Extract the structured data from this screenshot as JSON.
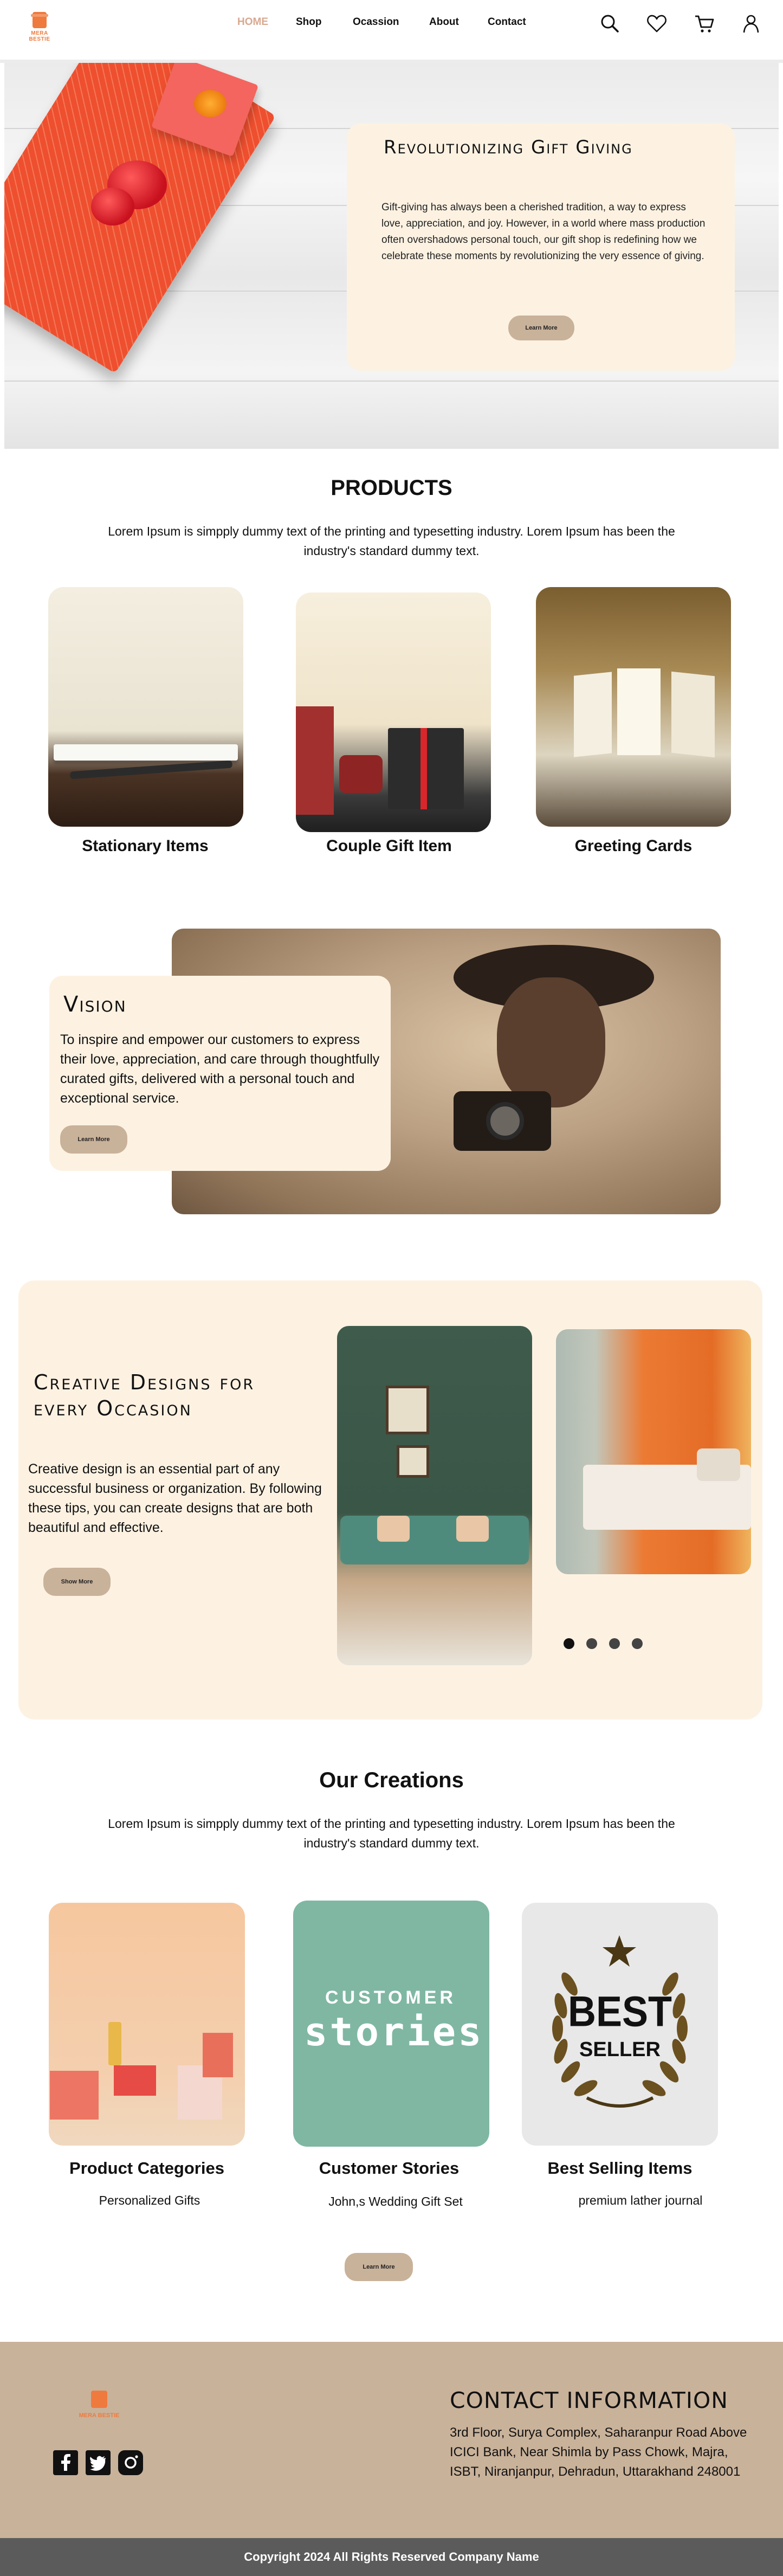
{
  "brand": {
    "logo_text": "MERA BESTIE",
    "accent": "#ef7a3e",
    "cream": "#fdf2e2",
    "tan": "#c9b29a"
  },
  "nav": {
    "items": [
      "HOME",
      "Shop",
      "Ocassion",
      "About",
      "Contact"
    ],
    "active": "HOME",
    "icons": [
      "search-icon",
      "heart-icon",
      "cart-icon",
      "user-icon"
    ]
  },
  "hero": {
    "title": "Revolutionizing Gift Giving",
    "text": "Gift-giving has always been a cherished tradition, a way to express love, appreciation, and joy. However, in a world where mass production often overshadows personal touch, our gift shop is redefining how we celebrate these moments by revolutionizing the very essence of giving.",
    "button": "Learn More"
  },
  "products": {
    "title": "PRODUCTS",
    "subtitle": "Lorem Ipsum is simpply dummy text of the printing and typesetting industry. Lorem Ipsum has been the industry's standard dummy text.",
    "items": [
      {
        "label": "Stationary Items"
      },
      {
        "label": "Couple Gift Item"
      },
      {
        "label": "Greeting Cards"
      }
    ]
  },
  "vision": {
    "title": "Vision",
    "text": "To inspire and empower our customers to express their love, appreciation, and care through thoughtfully curated gifts, delivered with a personal touch and exceptional service.",
    "button": "Learn More"
  },
  "creative": {
    "title": "Creative Designs for every Occasion",
    "text": "Creative design is an essential part of any successful business or organization. By following these tips, you can create designs that are both beautiful and effective.",
    "button": "Show More",
    "slides_count": 4,
    "active_slide": 1
  },
  "creations": {
    "title": "Our Creations",
    "subtitle": "Lorem Ipsum is simpply dummy text of the printing and typesetting industry. Lorem Ipsum has been the industry's standard dummy text.",
    "items": [
      {
        "label": "Product Categories",
        "sub": "Personalized Gifts"
      },
      {
        "label": "Customer Stories",
        "sub": "John,s Wedding Gift Set",
        "image_text_top": "CUSTOMER",
        "image_text_bottom": "stories"
      },
      {
        "label": "Best Selling Items",
        "sub": "premium lather journal",
        "badge_top": "BEST",
        "badge_bottom": "SELLER"
      }
    ],
    "button": "Learn More"
  },
  "footer": {
    "logo_text": "MERA BESTIE",
    "contact_title": "CONTACT INFORMATION",
    "address": "3rd Floor, Surya Complex, Saharanpur Road Above ICICI Bank, Near Shimla by Pass Chowk, Majra, ISBT, Niranjanpur, Dehradun, Uttarakhand 248001",
    "socials": [
      "facebook-icon",
      "twitter-icon",
      "instagram-icon"
    ],
    "copyright": "Copyright 2024 All Rights Reserved Company Name"
  }
}
